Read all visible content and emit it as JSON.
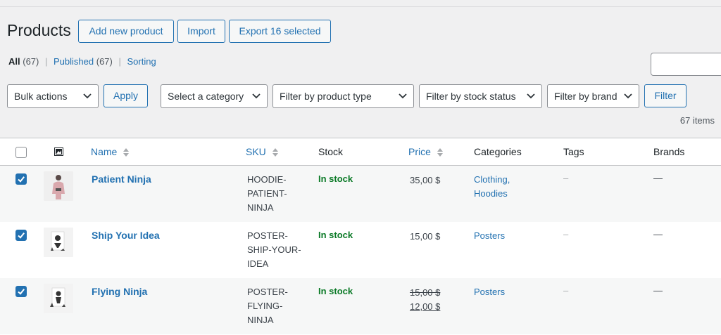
{
  "header": {
    "title": "Products",
    "add_new": "Add new product",
    "import": "Import",
    "export": "Export 16 selected"
  },
  "views": {
    "all_label": "All",
    "all_count": "(67)",
    "published_label": "Published",
    "published_count": "(67)",
    "sorting_label": "Sorting",
    "separator": "|"
  },
  "filters": {
    "bulk_actions": "Bulk actions",
    "apply": "Apply",
    "category": "Select a category",
    "product_type": "Filter by product type",
    "stock_status": "Filter by stock status",
    "brand": "Filter by brand",
    "filter_button": "Filter"
  },
  "items_count": "67 items",
  "table": {
    "columns": {
      "name": "Name",
      "sku": "SKU",
      "stock": "Stock",
      "price": "Price",
      "categories": "Categories",
      "tags": "Tags",
      "brands": "Brands"
    },
    "rows": [
      {
        "checked": true,
        "name": "Patient Ninja",
        "sku_lines": [
          "HOODIE-",
          "PATIENT-",
          "NINJA"
        ],
        "stock": "In stock",
        "price": "35,00 $",
        "categories": [
          "Clothing,",
          "Hoodies"
        ],
        "tags": "–",
        "brands": "—",
        "thumb_icon": "hoodie-icon"
      },
      {
        "checked": true,
        "name": "Ship Your Idea",
        "sku_lines": [
          "POSTER-",
          "SHIP-YOUR-",
          "IDEA"
        ],
        "stock": "In stock",
        "price": "15,00 $",
        "categories": [
          "Posters"
        ],
        "tags": "–",
        "brands": "—",
        "thumb_icon": "poster-icon"
      },
      {
        "checked": true,
        "name": "Flying Ninja",
        "sku_lines": [
          "POSTER-",
          "FLYING-",
          "NINJA"
        ],
        "stock": "In stock",
        "price_old": "15,00 $",
        "price_new": "12,00 $",
        "categories": [
          "Posters"
        ],
        "tags": "–",
        "brands": "—",
        "thumb_icon": "poster-icon"
      }
    ]
  },
  "colors": {
    "accent": "#2271b1",
    "in_stock": "#0b7a27",
    "background": "#f0f0f1"
  }
}
